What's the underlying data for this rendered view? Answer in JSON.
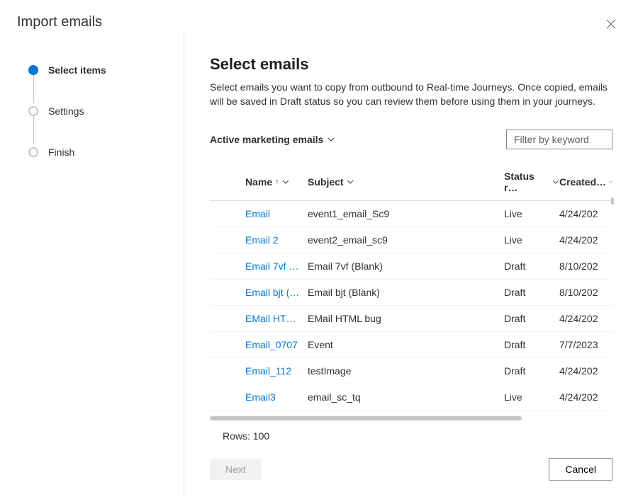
{
  "dialog": {
    "title": "Import emails",
    "close_icon": "close"
  },
  "stepper": {
    "steps": [
      {
        "label": "Select items",
        "active": true
      },
      {
        "label": "Settings",
        "active": false
      },
      {
        "label": "Finish",
        "active": false
      }
    ]
  },
  "panel": {
    "title": "Select emails",
    "description": "Select emails you want to copy from outbound to Real-time Journeys. Once copied, emails will be saved in Draft status so you can review them before using them in your journeys.",
    "view_selector": "Active marketing emails",
    "filter_placeholder": "Filter by keyword"
  },
  "table": {
    "columns": {
      "name": "Name",
      "subject": "Subject",
      "status": "Status r…",
      "created": "Created…"
    },
    "rows": [
      {
        "name": "Email",
        "subject": "event1_email_Sc9",
        "status": "Live",
        "created": "4/24/202"
      },
      {
        "name": "Email 2",
        "subject": "event2_email_sc9",
        "status": "Live",
        "created": "4/24/202"
      },
      {
        "name": "Email 7vf …",
        "subject": "Email 7vf (Blank)",
        "status": "Draft",
        "created": "8/10/202"
      },
      {
        "name": "Email bjt (…",
        "subject": "Email bjt (Blank)",
        "status": "Draft",
        "created": "8/10/202"
      },
      {
        "name": "EMail HT…",
        "subject": "EMail HTML bug",
        "status": "Draft",
        "created": "4/24/202"
      },
      {
        "name": "Email_0707",
        "subject": "Event",
        "status": "Draft",
        "created": "7/7/2023"
      },
      {
        "name": "Email_112",
        "subject": "testImage",
        "status": "Draft",
        "created": "4/24/202"
      },
      {
        "name": "Email3",
        "subject": "email_sc_tq",
        "status": "Live",
        "created": "4/24/202"
      }
    ],
    "row_count_label": "Rows: 100",
    "total_rows": 100
  },
  "footer": {
    "next_label": "Next",
    "cancel_label": "Cancel"
  }
}
